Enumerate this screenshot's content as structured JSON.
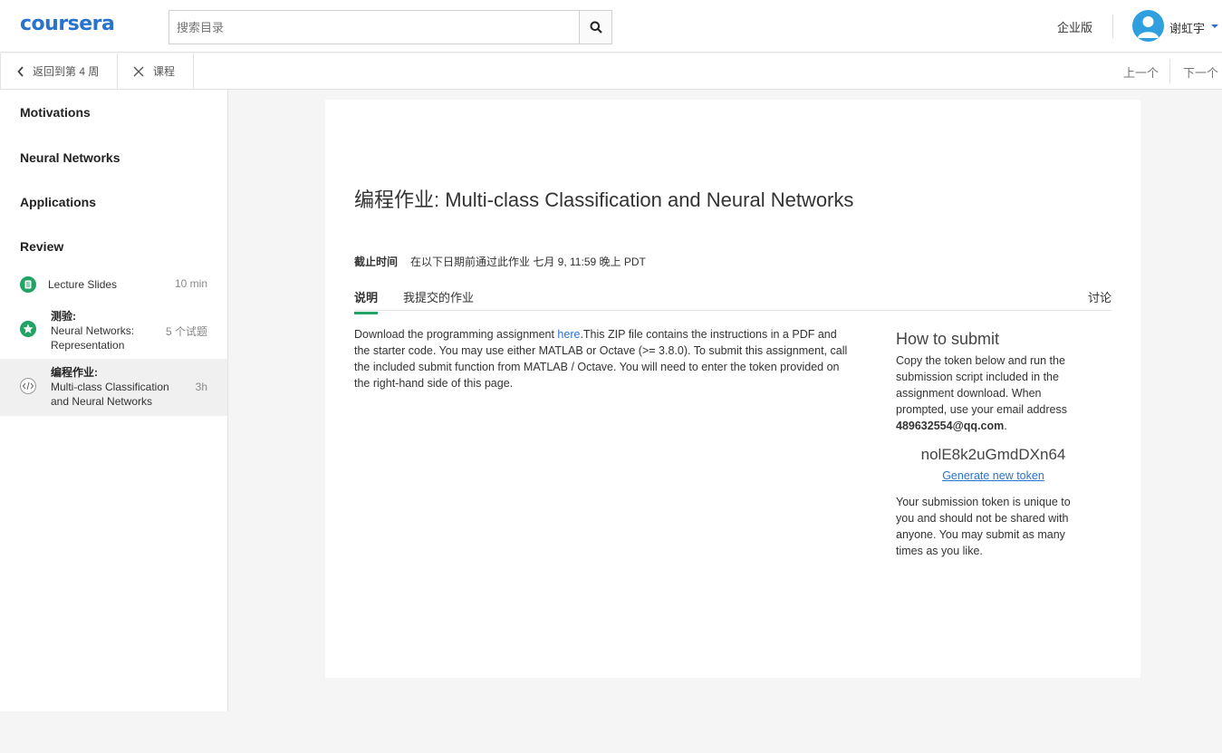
{
  "header": {
    "logo": "coursera",
    "search_placeholder": "搜索目录",
    "enterprise": "企业版",
    "username": "谢虹宇"
  },
  "subnav": {
    "back": "返回到第 4 周",
    "close": "课程",
    "prev": "上一个",
    "next": "下一个"
  },
  "sidebar": {
    "sections": [
      "Motivations",
      "Neural Networks",
      "Applications",
      "Review"
    ],
    "items": [
      {
        "kind": "",
        "title": "Lecture Slides",
        "duration": "10 min",
        "icon": "slides-icon"
      },
      {
        "kind": "测验:",
        "title": "Neural Networks: Representation",
        "duration": "5 个试题",
        "icon": "quiz-star-icon"
      },
      {
        "kind": "编程作业:",
        "title": "Multi-class Classification and Neural Networks",
        "duration": "3h",
        "icon": "code-icon"
      }
    ]
  },
  "content": {
    "title_prefix": "编程作业: ",
    "title": "Multi-class Classification and Neural Networks",
    "deadline_label": "截止时间",
    "deadline_text": "在以下日期前通过此作业 七月 9, 11:59 晚上 PDT",
    "tabs": [
      "说明",
      "我提交的作业"
    ],
    "discuss": "讨论",
    "desc_before": "Download the programming assignment ",
    "desc_link": "here",
    "desc_after": ".This ZIP file contains the instructions in a PDF and the starter code. You may use either MATLAB or Octave (>= 3.8.0). To submit this assignment, call the included submit function from MATLAB / Octave. You will need to enter the token provided on the right-hand side of this page.",
    "submit": {
      "heading": "How to submit",
      "instructions": "Copy the token below and run the submission script included in the assignment download. When prompted, use your email address ",
      "email": "489632554@qq.com",
      "period": ".",
      "token": "nolE8k2uGmdDXn64",
      "generate": "Generate new token",
      "unique_note": "Your submission token is unique to you and should not be shared with anyone. You may submit as many times as you like."
    }
  },
  "colors": {
    "brand": "#2a73cc",
    "green": "#21a366",
    "avatar": "#2f9fdf"
  }
}
